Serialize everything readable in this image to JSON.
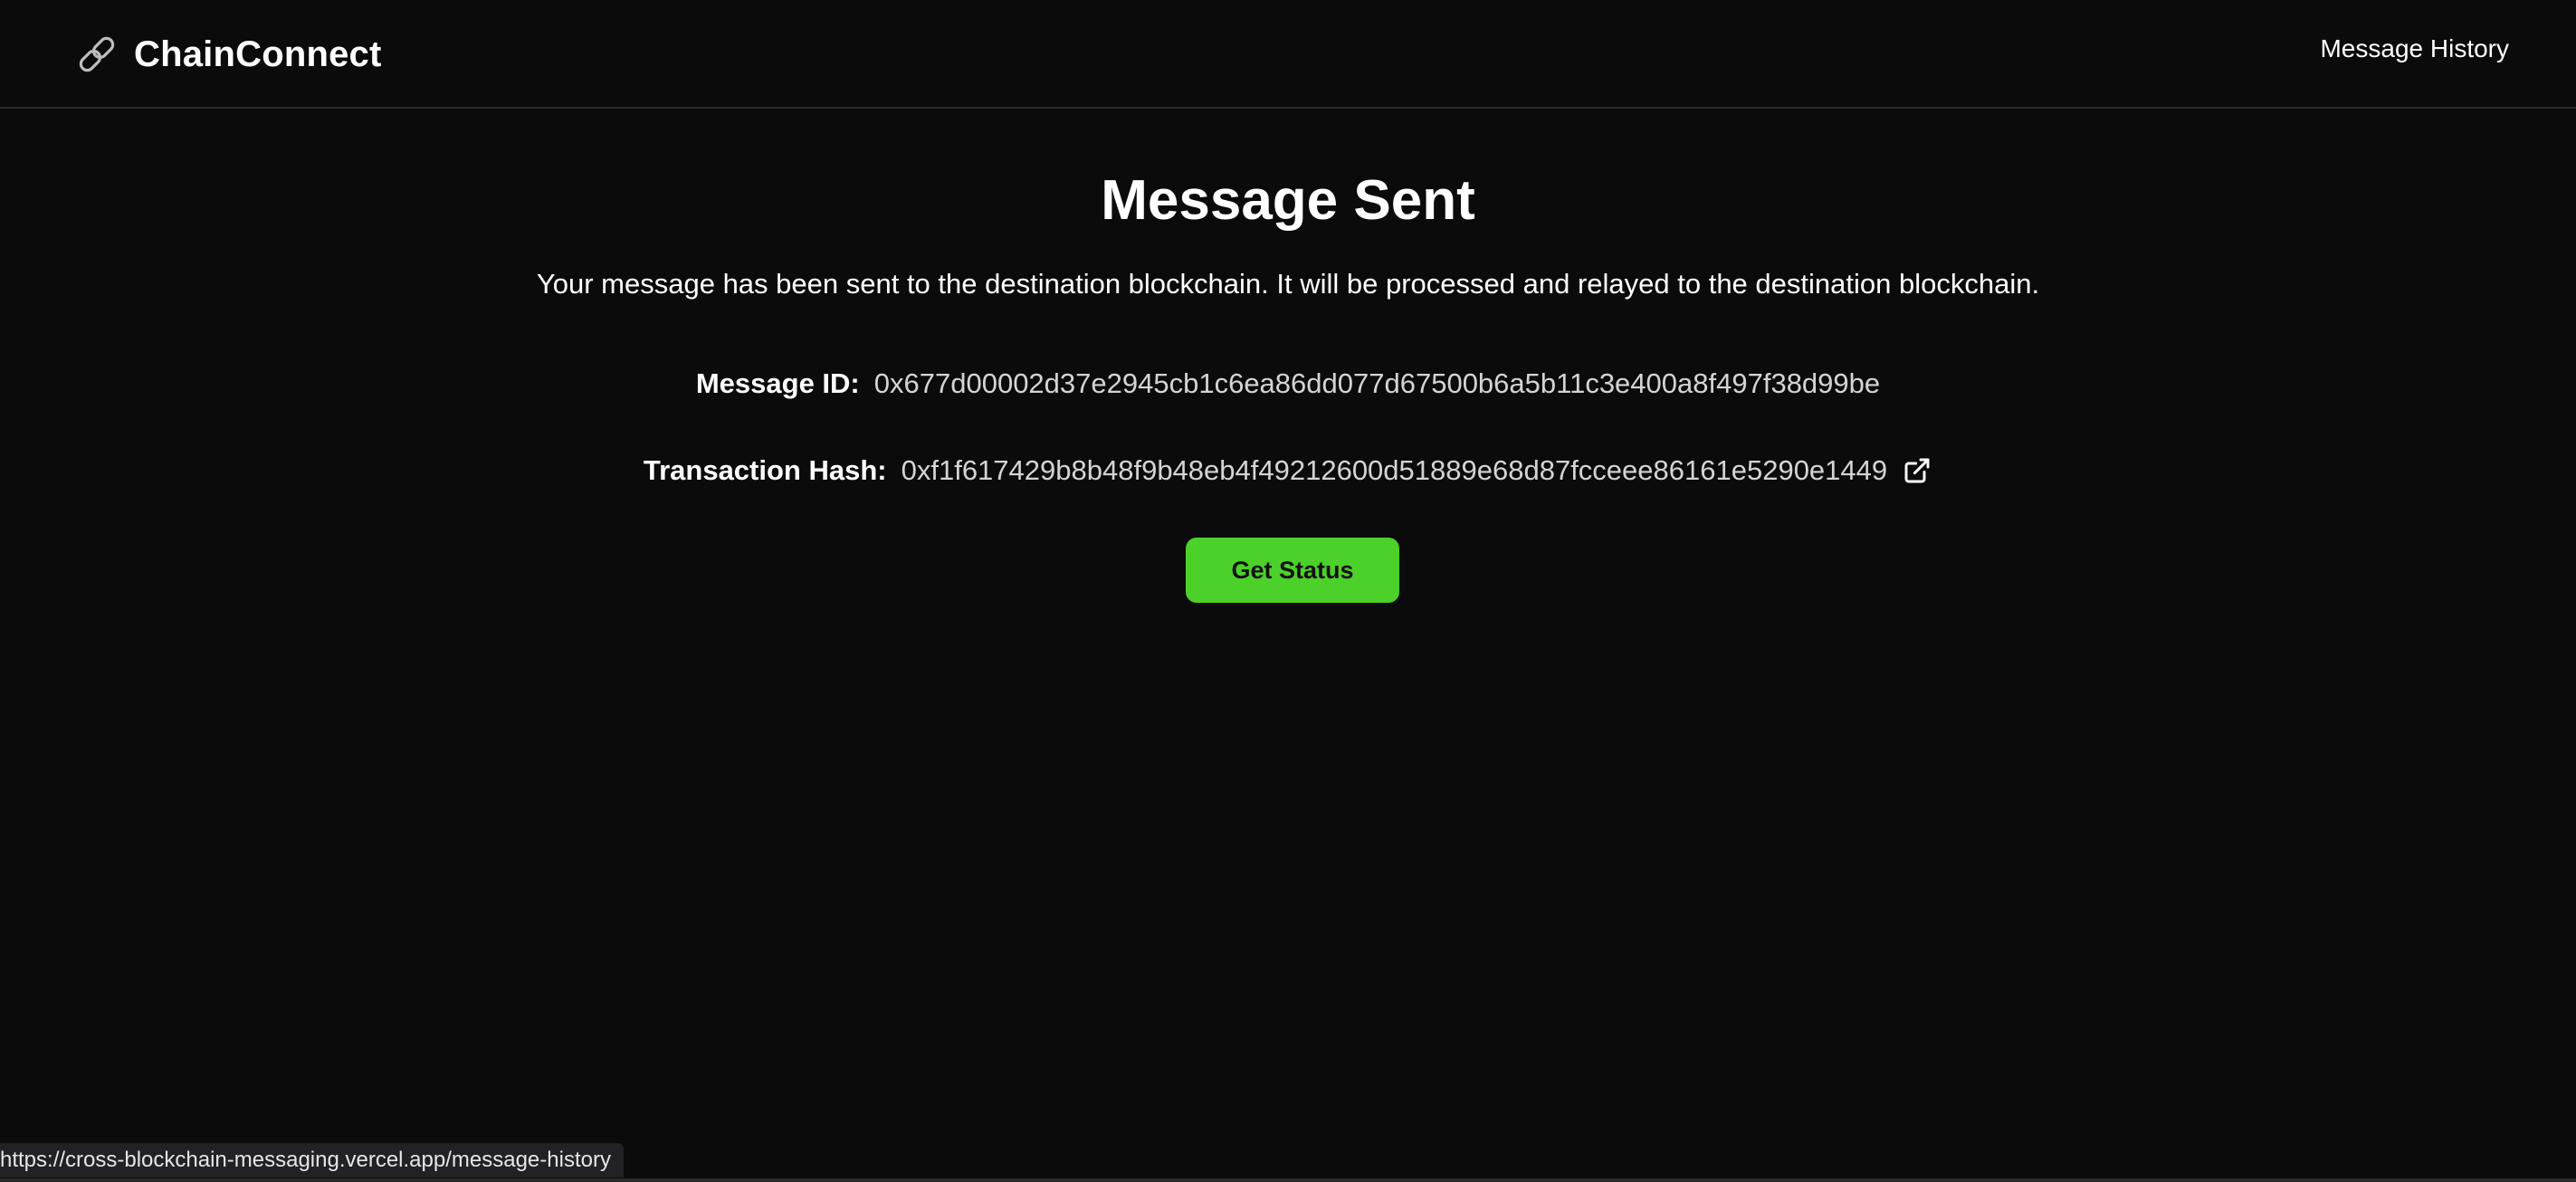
{
  "header": {
    "brand_name": "ChainConnect",
    "brand_icon": "chain-link-icon",
    "nav_link": "Message History"
  },
  "main": {
    "title": "Message Sent",
    "description": "Your message has been sent to the destination blockchain. It will be processed and relayed to the destination blockchain.",
    "message_id_label": "Message ID:",
    "message_id_value": "0x677d00002d37e2945cb1c6ea86dd077d67500b6a5b11c3e400a8f497f38d99be",
    "tx_hash_label": "Transaction Hash:",
    "tx_hash_value": "0xf1f617429b8b48f9b48eb4f49212600d51889e68d87fcceee86161e5290e1449",
    "external_icon": "external-link-icon",
    "button_label": "Get Status",
    "button_color": "#4cd12a"
  },
  "statusbar": {
    "url": "https://cross-blockchain-messaging.vercel.app/message-history"
  },
  "colors": {
    "background": "#0b0b0b",
    "text": "#ffffff",
    "muted_text": "#d4d4d4",
    "accent": "#4cd12a"
  }
}
